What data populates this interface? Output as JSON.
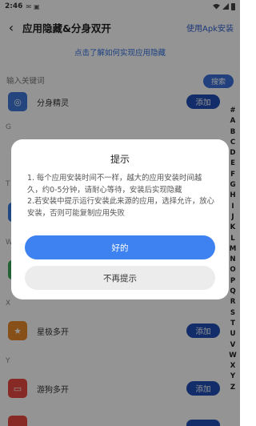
{
  "status_bar": {
    "time": "2:46"
  },
  "app_bar": {
    "title": "应用隐藏&分身双开",
    "apk_link": "使用Apk安装"
  },
  "help_link": "点击了解如何实现应用隐藏",
  "search": {
    "placeholder": "输入关键词",
    "button": "搜索"
  },
  "list": {
    "sections": [
      "G",
      "T",
      "W",
      "X",
      "Y"
    ],
    "apps": [
      {
        "name": "分身精灵",
        "button": "添加",
        "icon_color": "#3f78d8"
      },
      {
        "name": "",
        "button": "",
        "icon_color": "#3a7be0"
      },
      {
        "name": "",
        "button": "",
        "icon_color": "#3aa856"
      },
      {
        "name": "星极多开",
        "button": "添加",
        "icon_color": "#e88a2a"
      },
      {
        "name": "游狗多开",
        "button": "添加",
        "icon_color": "#e8473e"
      },
      {
        "name": "",
        "button": "",
        "icon_color": "#e8473e"
      }
    ]
  },
  "index_letters": [
    "#",
    "A",
    "B",
    "C",
    "D",
    "E",
    "F",
    "G",
    "H",
    "I",
    "J",
    "K",
    "L",
    "M",
    "N",
    "O",
    "P",
    "Q",
    "R",
    "S",
    "T",
    "U",
    "V",
    "W",
    "X",
    "Y",
    "Z"
  ],
  "dialog": {
    "title": "提示",
    "line1": "1. 每个应用安装时间不一样，越大的应用安装时间越久，约0-5分钟，请耐心等待，安装后实现隐藏",
    "line2": "2.若安装中提示运行安装此来源的应用，选择允许，放心安装，否则可能复制应用失败",
    "confirm": "好的",
    "dismiss": "不再提示"
  }
}
